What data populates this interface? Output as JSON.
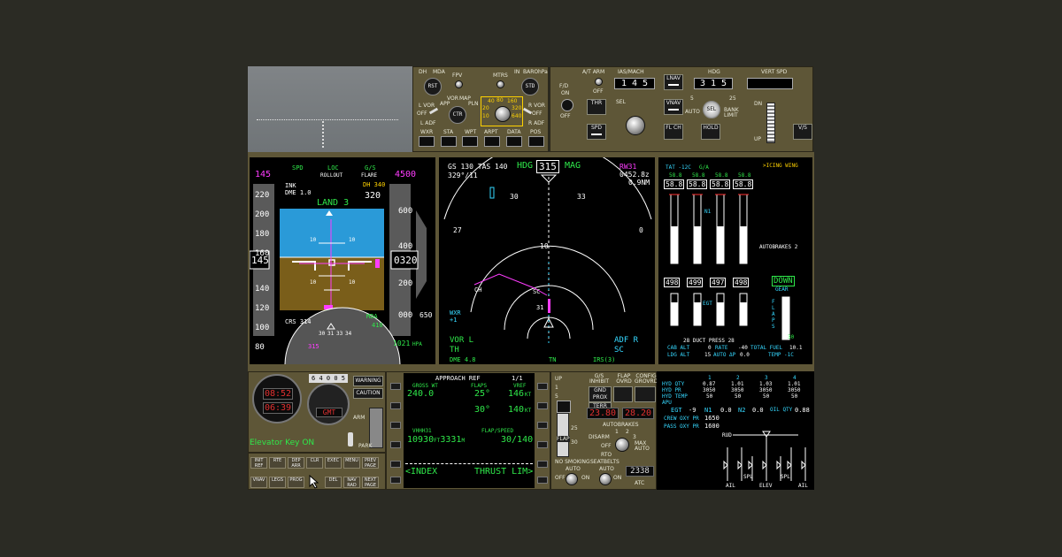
{
  "efis": {
    "dh_label": "DH",
    "mda_label": "MDA",
    "fpv_label": "FPV",
    "mtrs_label": "MTRS",
    "in_label": "IN",
    "baro_label": "BARO",
    "hpa_label": "hPa",
    "rst_label": "RST",
    "std_label": "STD",
    "lvor_label": "L VOR",
    "off_label": "OFF",
    "adf_l_label": "L ADF",
    "app_label": "APP",
    "vor_label": "VOR",
    "map_label": "MAP",
    "pln_label": "PLN",
    "ctr_label": "CTR",
    "ranges": [
      "40",
      "80",
      "160",
      "20",
      "320",
      "10",
      "640"
    ],
    "rvor_label": "R VOR",
    "radf_label": "R ADF",
    "buttons": [
      "WXR",
      "STA",
      "WPT",
      "ARPT",
      "DATA",
      "POS"
    ]
  },
  "mcp": {
    "fd_label": "F/D",
    "on_label": "ON",
    "off_label": "OFF",
    "atarm_label": "A/T ARM",
    "thr_label": "THR",
    "spd_label": "SPD",
    "sel_label": "SEL",
    "ias_mach_label": "IAS/MACH",
    "ias_value": "1 4 5",
    "lnav_label": "LNAV",
    "vnav_label": "VNAV",
    "flch_label": "FL CH",
    "hdg_label": "HDG",
    "hdg_value": "3 1 5",
    "auto_label": "AUTO",
    "bank_label": "BANK LIMIT",
    "bank_5": "5",
    "bank_25": "25",
    "hold_label": "HOLD",
    "vs_header": "VERT SPD",
    "vs_value": "",
    "dn_label": "DN",
    "up_label": "UP",
    "vs_btn": "V/S"
  },
  "pfd": {
    "speed_bug": "145",
    "alt_bug": "4500",
    "fma": [
      "SPD",
      "LOC",
      "G/S"
    ],
    "fma2": [
      "ROLLOUT",
      "FLARE"
    ],
    "ink": "INK",
    "dme": "DME 1.0",
    "dh": "DH 340",
    "radio_alt": "320",
    "land": "LAND 3",
    "speed_ticks": [
      "220",
      "200",
      "180",
      "160",
      "140",
      "120",
      "100",
      "80"
    ],
    "alt_ticks": [
      "600",
      "400",
      "200",
      "000"
    ],
    "speed_current": "145",
    "alt_current": "0320",
    "vs_value": "650",
    "pitch_marks": [
      "10",
      "10",
      "10",
      "10"
    ],
    "crs": "CRS 314",
    "mda_label": "MDA",
    "mda_value": "410",
    "baro": "1021",
    "baro_unit": "HPA",
    "hdg_bug": "315",
    "compass": [
      "30",
      "31",
      "33",
      "34"
    ]
  },
  "nd": {
    "gs_label": "GS",
    "gs": "130",
    "tas_label": "TAS",
    "tas": "140",
    "wind": "329°/11",
    "hdg_label": "HDG",
    "hdg": "315",
    "mag": "MAG",
    "wpt": "RW31",
    "eta": "0452.8z",
    "dist": "0.9NM",
    "arc": [
      "30",
      "33",
      "27",
      "0",
      "10"
    ],
    "fix1": "CH",
    "fix2": "SC",
    "rwy": "31",
    "wxr": "WXR",
    "wxr_val": "+1",
    "vor_l": "VOR L",
    "th": "TH",
    "dme": "DME 4.8",
    "adf_r": "ADF R",
    "sc": "SC",
    "tn": "TN",
    "irs": "IRS(3)"
  },
  "eicas": {
    "tat": "TAT -12C",
    "ga": "G/A",
    "icing": ">ICING WING",
    "n1_top": [
      "58.8",
      "58.8",
      "58.8",
      "58.8"
    ],
    "n1_box": [
      "58.8",
      "58.8",
      "58.8",
      "58.8"
    ],
    "n1_label": "N1",
    "egt": [
      "498",
      "499",
      "497",
      "498"
    ],
    "egt_label": "EGT",
    "autobrakes": "AUTOBRAKES 2",
    "gear_status": "DOWN",
    "gear_label": "GEAR",
    "flaps_label": "FLAPS",
    "flaps_value": "30",
    "duct": "28 DUCT PRESS 28",
    "cab_alt_label": "CAB ALT",
    "cab_alt": "0",
    "rate_label": "RATE",
    "rate": "-40",
    "ldg_alt_label": "LDG ALT",
    "ldg_alt": "15",
    "auto_dp": "AUTO ΔP",
    "dp": "0.0",
    "total_fuel": "TOTAL FUEL",
    "fuel_value": "10.1",
    "temp": "TEMP -1C"
  },
  "clock": {
    "chr": "08:52",
    "et": "06:39",
    "gmt": "GMT",
    "odo": "6 4 0 0 5"
  },
  "alerts": {
    "warning": "WARNING",
    "caution": "CAUTION",
    "arm": "ARM",
    "park": "PARK",
    "elevator": "Elevator Key ON"
  },
  "cdu": {
    "title": "APPROACH REF",
    "page": "1/1",
    "gross_wt_label": "GROSS WT",
    "gross_wt": "240.0",
    "flaps_label": "FLAPS",
    "vref_label": "VREF",
    "flaps1": "25°",
    "vref1": "146",
    "flaps2": "30°",
    "vref2": "140",
    "kt": "KT",
    "rwy_label": "VHHH31",
    "rwy_len": "10930",
    "ft": "FT",
    "rwy_len_m": "3331",
    "m": "M",
    "flapspd_label": "FLAP/SPEED",
    "flapspd": "30/140",
    "index": "<INDEX",
    "thrust": "THRUST LIM>",
    "keys1": [
      "INIT REF",
      "RTE",
      "DEP ARR",
      "CLR",
      "EXEC",
      "MENU",
      "PREV PAGE"
    ],
    "keys2": [
      "VNAV",
      "LEGS",
      "PROG",
      "",
      "DEL",
      "NAV RAD",
      "NEXT PAGE"
    ]
  },
  "center": {
    "flap_up": "UP",
    "flap_1": "1",
    "flap_5": "5",
    "flap_25": "25",
    "flap_30": "30",
    "flap_label": "FLAP",
    "gs_inhibit": "G/S INHIBIT",
    "flap_ovrd": "FLAP OVRD",
    "config_ovrd": "CONFIG GROVRD",
    "gnd_prox": "GND PROX",
    "terr": "TERR OVRD",
    "dig1": "23.80",
    "dig2": "28.20",
    "autobrakes": "AUTOBRAKES",
    "rto": "RTO",
    "disarm": "DISARM",
    "off": "OFF",
    "max_auto": "MAX AUTO",
    "ab_1": "1",
    "ab_2": "2",
    "ab_3": "3",
    "nosmoking": "NO SMOKING",
    "seatbelts": "SEATBELTS",
    "auto": "AUTO",
    "on": "ON",
    "xpdr": "2338",
    "atc": "ATC"
  },
  "status": {
    "hyd_cols": [
      "1",
      "2",
      "3",
      "4"
    ],
    "hyd_qty_label": "HYD QTY",
    "hyd_qty": [
      "0.87",
      "1.01",
      "1.03",
      "1.01"
    ],
    "hyd_pr_label": "HYD PR",
    "hyd_pr": [
      "3050",
      "3050",
      "3050",
      "3050"
    ],
    "hyd_temp_label": "HYD TEMP",
    "hyd_temp": [
      "50",
      "50",
      "50",
      "50"
    ],
    "apu_label": "APU",
    "egt_label": "EGT",
    "egt": "-9",
    "n1_label": "N1",
    "n1": "0.0",
    "n2_label": "N2",
    "n2": "0.0",
    "oilqty_label": "OIL QTY",
    "oilqty": "0.88",
    "crew_oxy_label": "CREW OXY PR",
    "crew_oxy": "1650",
    "pass_oxy_label": "PASS OXY PR",
    "pass_oxy": "1600",
    "rud": "RUD",
    "ail_l": "AIL",
    "spl_l": "SPL",
    "elev": "ELEV",
    "spl_r": "SPL",
    "ail_r": "AIL"
  }
}
